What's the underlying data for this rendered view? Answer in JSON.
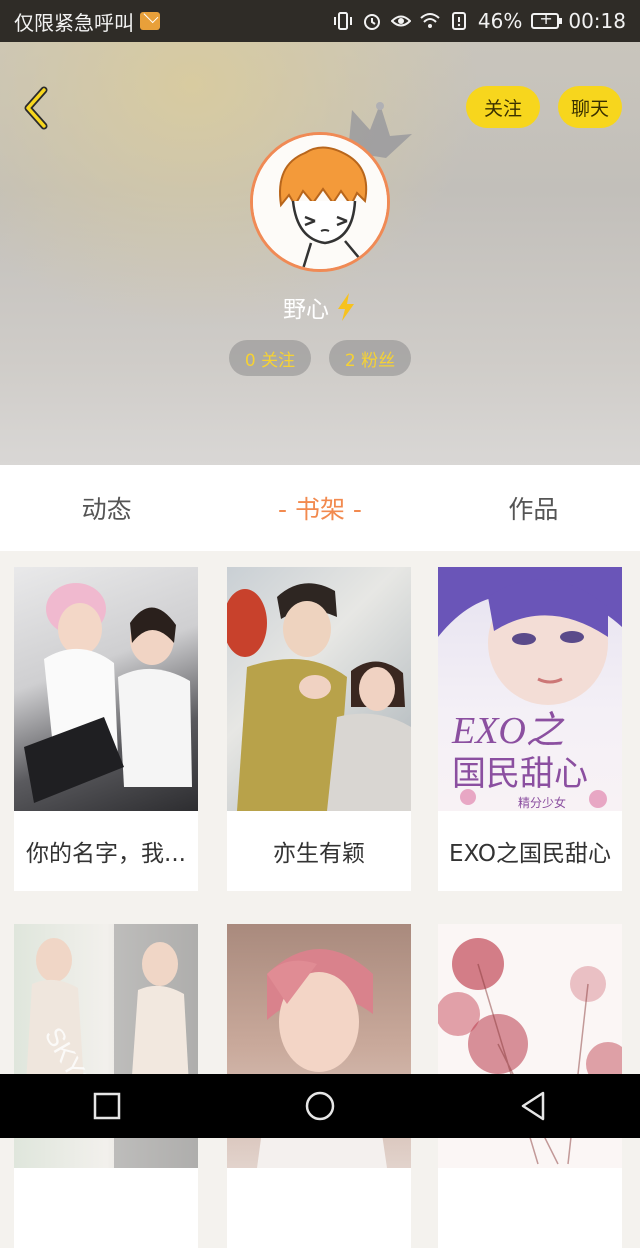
{
  "status_bar": {
    "carrier": "仅限紧急呼叫",
    "battery": "46%",
    "time": "00:18"
  },
  "header": {
    "follow_label": "关注",
    "chat_label": "聊天",
    "nickname": "野心",
    "following": "0 关注",
    "fans": "2 粉丝"
  },
  "tabs": [
    {
      "label": "动态"
    },
    {
      "label": "- 书架 -"
    },
    {
      "label": "作品"
    }
  ],
  "books": [
    {
      "title": "你的名字，我..."
    },
    {
      "title": "亦生有颖"
    },
    {
      "title": "EXO之国民甜心"
    },
    {
      "title": ""
    },
    {
      "title": ""
    },
    {
      "title": ""
    }
  ],
  "colors": {
    "accent": "#f28a4f",
    "button_yellow": "#f7d61d",
    "pill_text": "#f6d233"
  },
  "icons": [
    "back-icon",
    "lightning-icon",
    "crown-icon",
    "square-icon",
    "circle-icon",
    "triangle-icon"
  ]
}
